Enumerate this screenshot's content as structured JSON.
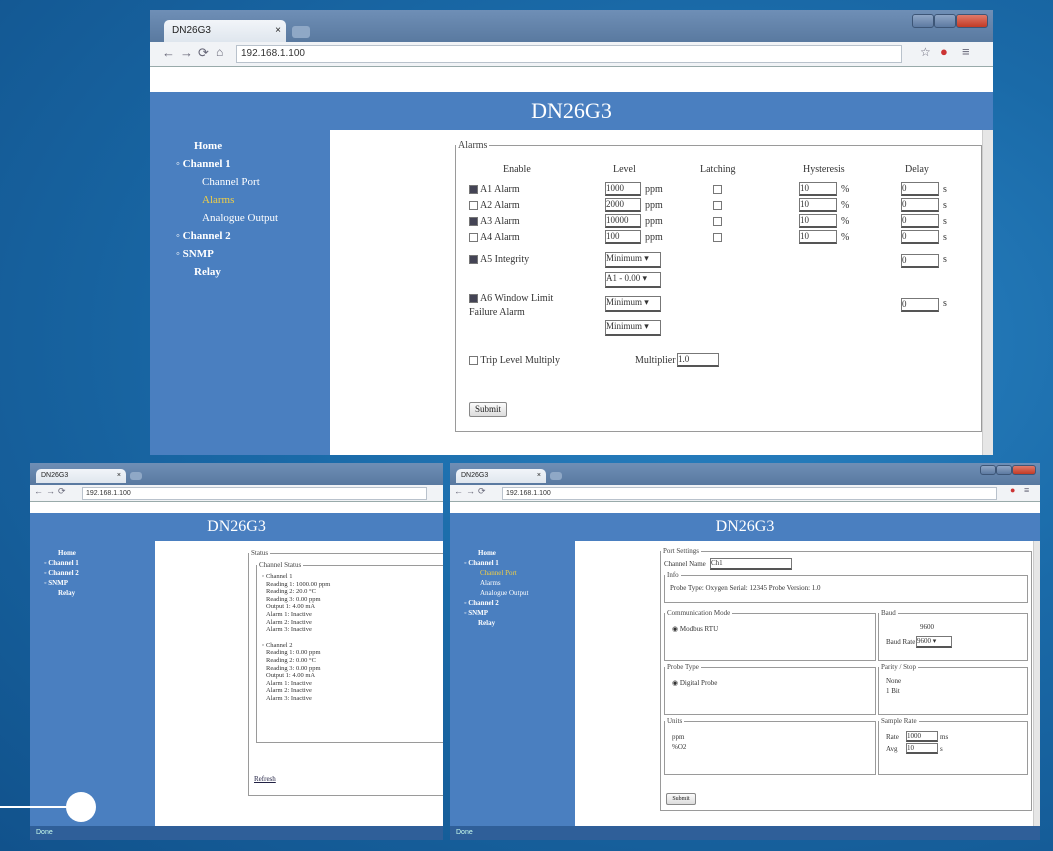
{
  "main": {
    "tab_label": "DN26G3",
    "url": "192.168.1.100",
    "banner_title": "DN26G3",
    "sidebar": [
      {
        "label": "Home",
        "level": 0,
        "selected": false
      },
      {
        "label": "Channel 1",
        "level": 0,
        "selected": false,
        "bullet": true
      },
      {
        "label": "Channel Port",
        "level": 1,
        "selected": false
      },
      {
        "label": "Alarms",
        "level": 1,
        "selected": true
      },
      {
        "label": "Analogue Output",
        "level": 1,
        "selected": false
      },
      {
        "label": "Channel 2",
        "level": 0,
        "selected": false,
        "bullet": true
      },
      {
        "label": "SNMP",
        "level": 0,
        "selected": false,
        "bullet": true
      },
      {
        "label": "Relay",
        "level": 0,
        "selected": false
      }
    ],
    "alarms": {
      "legend": "Alarms",
      "columns": [
        "Enable",
        "Level",
        "Latching",
        "Hysteresis",
        "Delay"
      ],
      "rows": [
        {
          "label": "A1 Alarm",
          "enabled": true,
          "level": "1000",
          "unit": "ppm",
          "latching": false,
          "hysteresis": "10",
          "hyst_unit": "%",
          "delay": "0",
          "delay_unit": "s"
        },
        {
          "label": "A2 Alarm",
          "enabled": false,
          "level": "2000",
          "unit": "ppm",
          "latching": false,
          "hysteresis": "10",
          "hyst_unit": "%",
          "delay": "0",
          "delay_unit": "s"
        },
        {
          "label": "A3 Alarm",
          "enabled": true,
          "level": "10000",
          "unit": "ppm",
          "latching": false,
          "hysteresis": "10",
          "hyst_unit": "%",
          "delay": "0",
          "delay_unit": "s"
        },
        {
          "label": "A4 Alarm",
          "enabled": false,
          "level": "100",
          "unit": "ppm",
          "latching": false,
          "hysteresis": "10",
          "hyst_unit": "%",
          "delay": "0",
          "delay_unit": "s"
        }
      ],
      "integrity": {
        "label": "A5 Integrity",
        "enabled": true,
        "select1": "Minimum",
        "select2": "A1 - 0.00",
        "delay": "0",
        "delay_unit": "s"
      },
      "window": {
        "label": "A6 Window Limit Failure Alarm",
        "enabled": true,
        "select1": "Minimum",
        "select2": "Minimum",
        "delay": "0",
        "delay_unit": "s"
      },
      "trip": {
        "label": "Trip Level Multiply",
        "enabled": false,
        "multiplier_label": "Multiplier",
        "multiplier_value": "1.0"
      },
      "submit": "Submit"
    }
  },
  "left": {
    "tab_label": "DN26G3",
    "url": "192.168.1.100",
    "banner_title": "DN26G3",
    "sidebar": [
      "Home",
      "Channel 1",
      "Channel 2",
      "SNMP",
      "Relay"
    ],
    "status_legend": "Status",
    "channel_legend": "Channel Status",
    "group1_title": "Channel 1",
    "group1_lines": [
      "Reading 1: 1000.00 ppm",
      "Reading 2: 20.0 °C",
      "Reading 3: 0.00 ppm",
      "Output 1: 4.00 mA",
      "Alarm 1: Inactive",
      "Alarm 2: Inactive",
      "Alarm 3: Inactive"
    ],
    "group2_title": "Channel 2",
    "group2_lines": [
      "Reading 1: 0.00 ppm",
      "Reading 2: 0.00 °C",
      "Reading 3: 0.00 ppm",
      "Output 1: 4.00 mA",
      "Alarm 1: Inactive",
      "Alarm 2: Inactive",
      "Alarm 3: Inactive"
    ],
    "link": "Refresh",
    "status_bar": "Done"
  },
  "right": {
    "tab_label": "DN26G3",
    "url": "192.168.1.100",
    "banner_title": "DN26G3",
    "sidebar": [
      {
        "label": "Home",
        "sel": false
      },
      {
        "label": "Channel 1",
        "sel": false
      },
      {
        "label": "Channel Port",
        "sel": true
      },
      {
        "label": "Alarms",
        "sel": false
      },
      {
        "label": "Analogue Output",
        "sel": false
      },
      {
        "label": "Channel 2",
        "sel": false
      },
      {
        "label": "SNMP",
        "sel": false
      },
      {
        "label": "Relay",
        "sel": false
      }
    ],
    "outer_legend": "Port Settings",
    "name_label": "Channel Name",
    "name_value": "Ch1",
    "info_legend": "Info",
    "info_text": "Probe Type: Oxygen  Serial: 12345  Probe Version: 1.0",
    "box_a_legend": "Communication Mode",
    "box_a_text": "Modbus RTU",
    "box_b_legend": "Baud",
    "box_b_text": "9600",
    "box_b_field_label": "Baud Rate",
    "box_b_field_value": "9600",
    "box_c_legend": "Probe Type",
    "box_c_text": "Digital Probe",
    "box_d_legend": "Parity / Stop",
    "box_d_lines": [
      "None",
      "1 Bit"
    ],
    "box_e_legend": "Units",
    "box_e_lines": [
      "ppm",
      "%O2"
    ],
    "box_f_legend": "Sample Rate",
    "box_f_rows": [
      {
        "label": "Rate",
        "value": "1000",
        "unit": "ms"
      },
      {
        "label": "Avg",
        "value": "10",
        "unit": "s"
      }
    ],
    "submit": "Submit",
    "status_bar": "Done"
  }
}
